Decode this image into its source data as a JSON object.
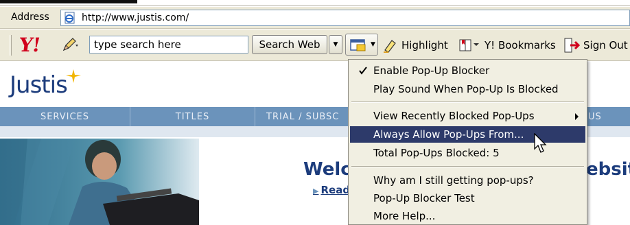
{
  "address_bar": {
    "label": "Address",
    "url": "http://www.justis.com/",
    "icon": "ie-page-icon"
  },
  "toolbar": {
    "logo": "Y!",
    "search_placeholder": "type search here",
    "search_button": "Search Web",
    "highlight_label": "Highlight",
    "bookmarks_label": "Y! Bookmarks",
    "signout_label": "Sign Out",
    "icons": [
      "pencil-icon",
      "popup-blocker-icon",
      "highlighter-icon",
      "bookmarks-icon",
      "sign-out-icon"
    ]
  },
  "site": {
    "logo": "Justis",
    "nav": [
      "SERVICES",
      "TITLES",
      "TRIAL / SUBSC",
      "US"
    ],
    "welcome": "Welc",
    "welcome_tail": "ebsit",
    "read_link": "Read"
  },
  "popup_menu": {
    "items": [
      {
        "label": "Enable Pop-Up Blocker",
        "checked": true
      },
      {
        "label": "Play Sound When Pop-Up Is Blocked"
      },
      {
        "label": "View Recently Blocked Pop-Ups",
        "submenu": true
      },
      {
        "label": "Always Allow Pop-Ups From...",
        "highlighted": true
      },
      {
        "label": "Total Pop-Ups Blocked: 5"
      },
      {
        "label": "Why am I still getting pop-ups?"
      },
      {
        "label": "Pop-Up Blocker Test"
      },
      {
        "label": "More Help..."
      }
    ]
  },
  "colors": {
    "chrome": "#ece9d8",
    "yahoo_red": "#d1001c",
    "nav_blue": "#6b93bb",
    "menu_highlight": "#2d3a6a",
    "brand_navy": "#1c3c7c"
  }
}
